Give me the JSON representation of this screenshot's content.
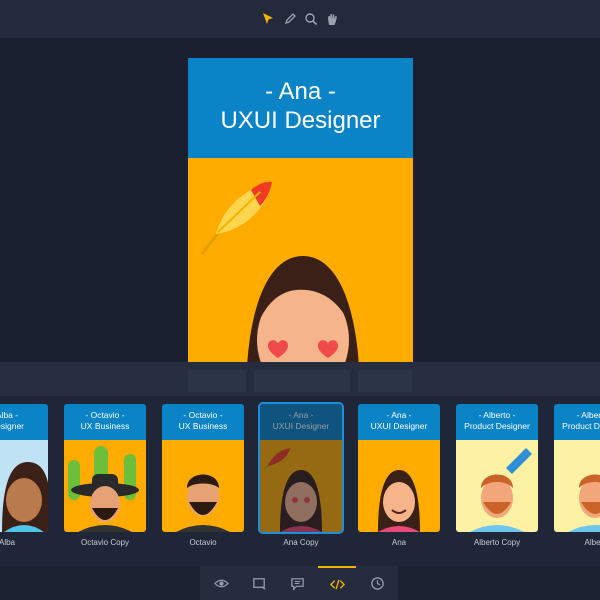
{
  "toolbar": {
    "tools": [
      {
        "icon": "pointer-icon",
        "active": true
      },
      {
        "icon": "pen-icon",
        "active": false
      },
      {
        "icon": "zoom-icon",
        "active": false
      },
      {
        "icon": "hand-icon",
        "active": false
      }
    ],
    "active_color": "#f5b400"
  },
  "artboard": {
    "name": "- Ana -",
    "role": "UXUI Designer",
    "header_color": "#0a84c6",
    "body_color": "#ffab00"
  },
  "cards": [
    {
      "name": "Alba -",
      "role": "Designer",
      "label": "Alba",
      "bg": "#bfe3f5"
    },
    {
      "name": "- Octavio -",
      "role": "UX Business",
      "label": "Octavio Copy",
      "bg": "#ffab00"
    },
    {
      "name": "- Octavio -",
      "role": "UX Business",
      "label": "Octavio",
      "bg": "#ffab00"
    },
    {
      "name": "- Ana -",
      "role": "UXUI Designer",
      "label": "Ana Copy",
      "bg": "#ffab00",
      "selected": true
    },
    {
      "name": "- Ana -",
      "role": "UXUI Designer",
      "label": "Ana",
      "bg": "#ffab00"
    },
    {
      "name": "- Alberto -",
      "role": "Product Designer",
      "label": "Alberto Copy",
      "bg": "#fdf2a3"
    },
    {
      "name": "- Alberto -",
      "role": "Product Designer",
      "label": "Albert",
      "bg": "#fdf2a3"
    }
  ],
  "bottom_tabs": [
    {
      "icon": "eye-icon",
      "active": false
    },
    {
      "icon": "artboard-icon",
      "active": false
    },
    {
      "icon": "comment-icon",
      "active": false
    },
    {
      "icon": "code-icon",
      "active": true
    },
    {
      "icon": "history-icon",
      "active": false
    }
  ]
}
